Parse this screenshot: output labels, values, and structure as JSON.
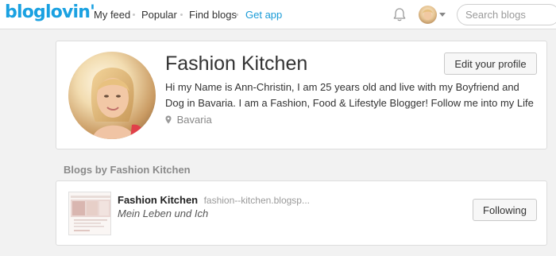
{
  "nav": {
    "logo": "bloglovin'",
    "links": [
      "My feed",
      "Popular",
      "Find blogs",
      "Get app"
    ],
    "search_placeholder": "Search blogs",
    "icons": [
      "bell-icon",
      "avatar",
      "chevron-down-icon"
    ],
    "colors": {
      "brand": "#1aa1e1",
      "accent_link": "#1a9bd7"
    }
  },
  "profile": {
    "name": "Fashion Kitchen",
    "bio": "Hi my Name is Ann-Christin, I am 25 years old and live with my Boyfriend and Dog in Bavaria. I am a Fashion, Food & Lifestyle Blogger! Follow me into my Life",
    "location": "Bavaria",
    "edit_button": "Edit your profile"
  },
  "blogs_section": {
    "title": "Blogs by Fashion Kitchen",
    "items": [
      {
        "title": "Fashion Kitchen",
        "url": "fashion--kitchen.blogsp...",
        "description": "Mein Leben und Ich",
        "button": "Following"
      }
    ]
  }
}
